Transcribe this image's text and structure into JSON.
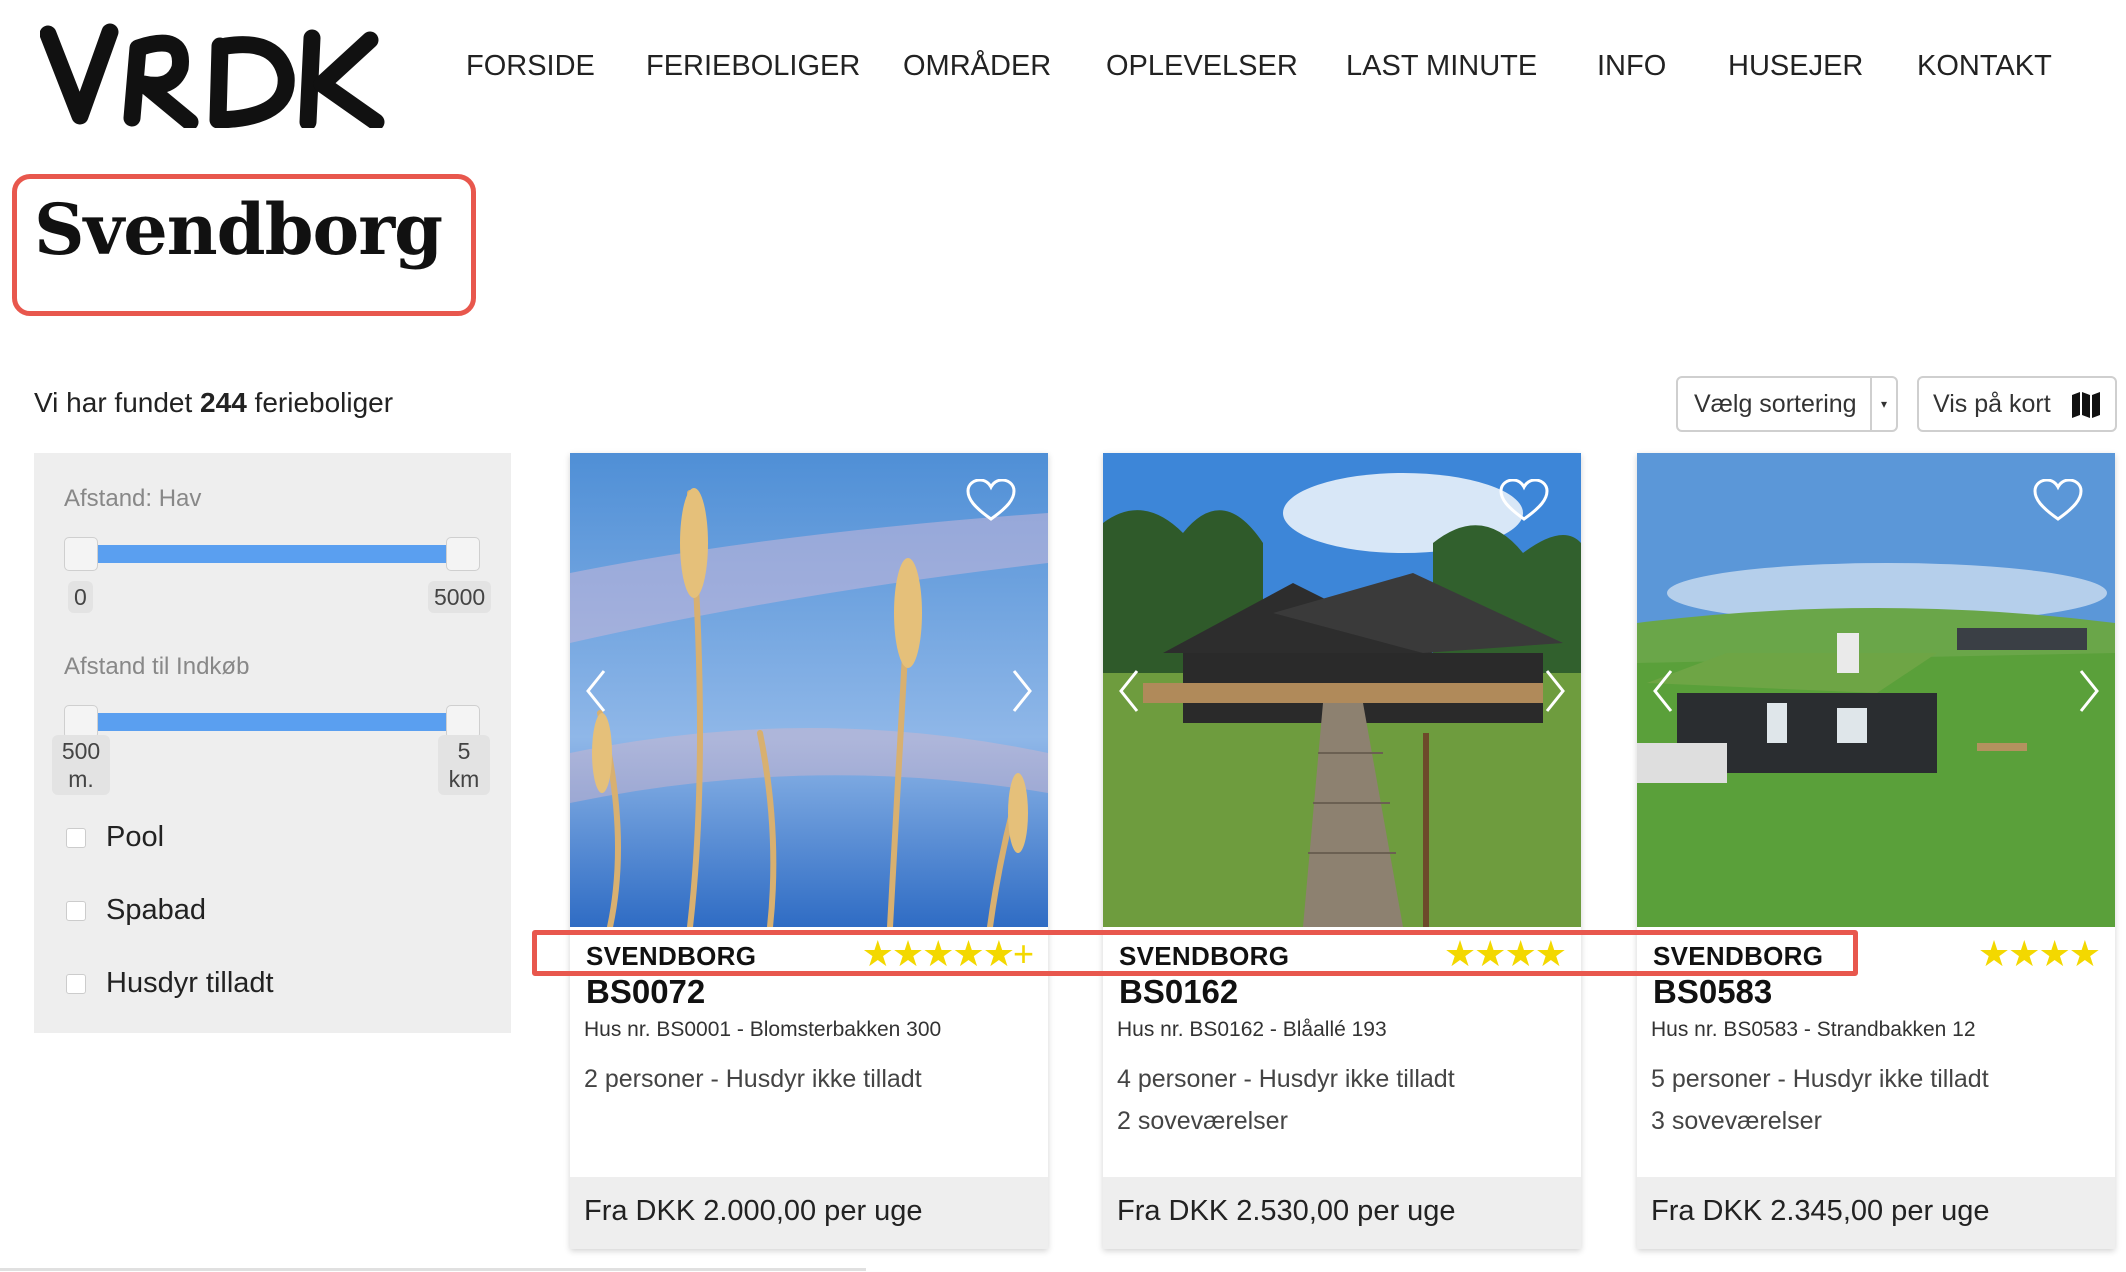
{
  "brand": {
    "logo_text": "VRDK"
  },
  "nav": {
    "items": [
      "FORSIDE",
      "FERIEBOLIGER",
      "OMRÅDER",
      "OPLEVELSER",
      "LAST MINUTE",
      "INFO",
      "HUSEJER",
      "KONTAKT"
    ]
  },
  "page": {
    "title": "Svendborg",
    "result_prefix": "Vi har fundet",
    "result_count": "244",
    "result_suffix": "ferieboliger"
  },
  "toolbar": {
    "sort_label": "Vælg sortering",
    "map_label": "Vis på kort"
  },
  "filters": {
    "distance_sea": {
      "label": "Afstand: Hav",
      "min": "0",
      "max": "5000"
    },
    "distance_shop": {
      "label": "Afstand til Indkøb",
      "min": "500 m.",
      "max": "5 km"
    },
    "checkboxes": [
      "Pool",
      "Spabad",
      "Husdyr tilladt"
    ]
  },
  "cards": [
    {
      "city": "SVENDBORG",
      "stars": "★★★★★+",
      "rating": 5.5,
      "code": "BS0072",
      "address": "Hus nr. BS0001 - Blomsterbakken 300",
      "info1": "2 personer - Husdyr ikke tilladt",
      "info2": "",
      "price": "Fra DKK 2.000,00 per uge"
    },
    {
      "city": "SVENDBORG",
      "stars": "★★★★",
      "rating": 4,
      "code": "BS0162",
      "address": "Hus nr. BS0162 - Blåallé 193",
      "info1": "4 personer - Husdyr ikke tilladt",
      "info2": "2 soveværelser",
      "price": "Fra DKK 2.530,00 per uge"
    },
    {
      "city": "SVENDBORG",
      "stars": "★★★★",
      "rating": 4,
      "code": "BS0583",
      "address": "Hus nr. BS0583 - Strandbakken 12",
      "info1": "5 personer - Husdyr ikke tilladt",
      "info2": "3 soveværelser",
      "price": "Fra DKK 2.345,00 per uge"
    }
  ],
  "colors": {
    "highlight": "#e8574d",
    "slider": "#5a9ff0",
    "stars": "#f3d800",
    "panel": "#eeeeee"
  },
  "icons": [
    "heart-icon",
    "chevron-left-icon",
    "chevron-right-icon",
    "map-icon",
    "caret-down-icon"
  ]
}
